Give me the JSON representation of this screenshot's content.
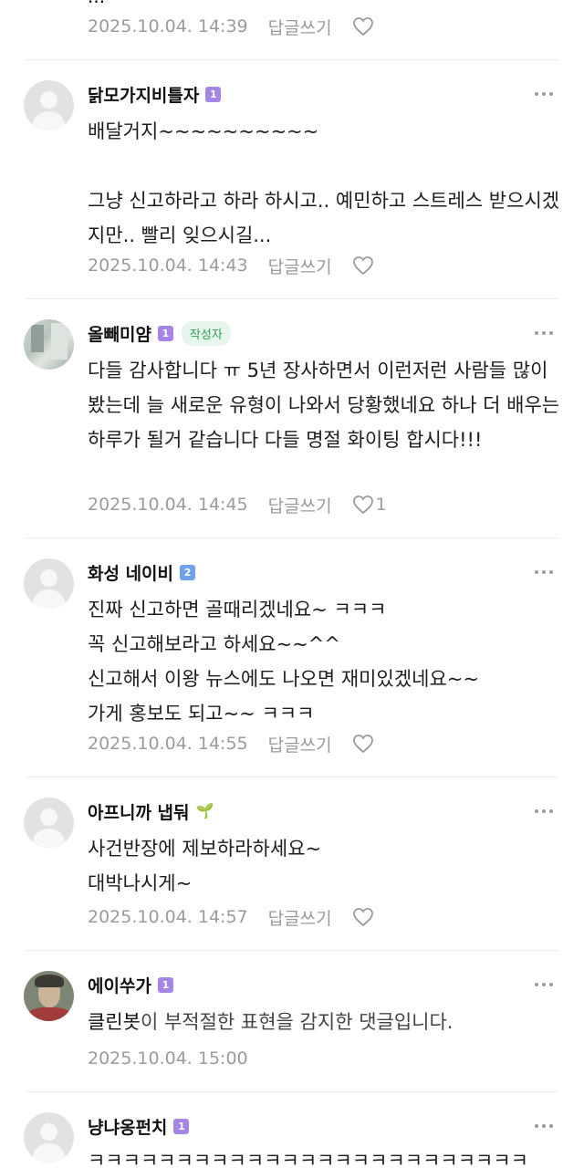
{
  "top": {
    "cut_text": "...",
    "date": "2025.10.04. 14:39",
    "reply_label": "답글쓰기"
  },
  "comments": [
    {
      "nickname": "닭모가지비틀자",
      "level": "1",
      "text": "배달거지~~~~~~~~~~\n\n그냥 신고하라고 하라 하시고.. 예민하고 스트레스 받으시겠지만.. 빨리 잊으시길...",
      "date": "2025.10.04. 14:43",
      "reply_label": "답글쓰기"
    },
    {
      "nickname": "올빼미얌",
      "level": "1",
      "author_tag": "작성자",
      "text": "다들 감사합니다 ㅠ 5년 장사하면서 이런저런 사람들 많이 봤는데 늘 새로운 유형이 나와서 당황했네요 하나 더 배우는 하루가 될거 같습니다 다들 명절 화이팅 합시다!!!",
      "date": "2025.10.04. 14:45",
      "reply_label": "답글쓰기",
      "likes": "1"
    },
    {
      "nickname": "화성 네이비",
      "level": "2",
      "text": "진짜 신고하면 골때리겠네요~ ㅋㅋㅋ\n꼭 신고해보라고 하세요~~^^\n신고해서 이왕 뉴스에도 나오면 재미있겠네요~~\n가게 홍보도 되고~~ ㅋㅋㅋ",
      "date": "2025.10.04. 14:55",
      "reply_label": "답글쓰기"
    },
    {
      "nickname": "아프니까 냅둬",
      "text": "사건반장에 제보하라하세요~\n대박나시게~",
      "date": "2025.10.04. 14:57",
      "reply_label": "답글쓰기"
    },
    {
      "nickname": "에이쑤가",
      "level": "1",
      "bot_name": "클린봇",
      "bot_rest": "이 부적절한 표현을 감지한 댓글입니다.",
      "date": "2025.10.04. 15:00"
    },
    {
      "nickname": "냥냐옹펀치",
      "level": "1",
      "text": "ㅋㅋㅋㅋㅋㅋㅋㅋㅋㅋㅋㅋㅋㅋㅋㅋㅋㅋㅋㅋㅋㅋㅋㅋㅋ"
    }
  ]
}
